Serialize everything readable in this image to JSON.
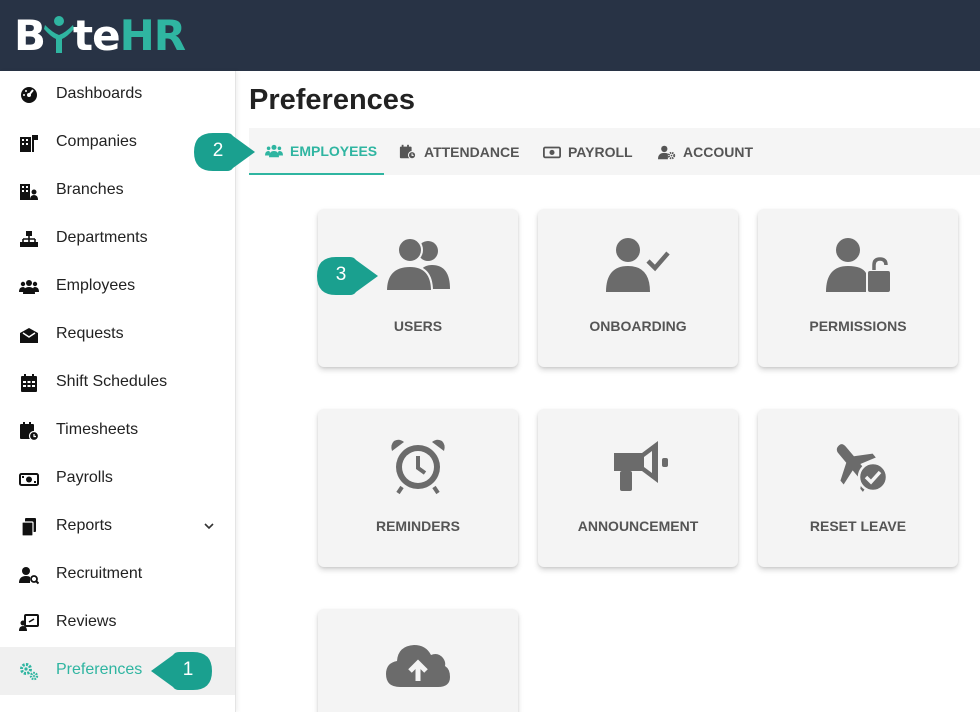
{
  "header": {
    "logo_prefix": "B",
    "logo_mid": "te",
    "logo_suffix": "HR"
  },
  "sidebar": {
    "items": [
      {
        "label": "Dashboards",
        "icon": "dashboard-gauge-icon"
      },
      {
        "label": "Companies",
        "icon": "building-flag-icon"
      },
      {
        "label": "Branches",
        "icon": "building-user-icon"
      },
      {
        "label": "Departments",
        "icon": "sitemap-icon"
      },
      {
        "label": "Employees",
        "icon": "users-icon"
      },
      {
        "label": "Requests",
        "icon": "envelope-open-icon"
      },
      {
        "label": "Shift Schedules",
        "icon": "calendar-icon"
      },
      {
        "label": "Timesheets",
        "icon": "calendar-clock-icon"
      },
      {
        "label": "Payrolls",
        "icon": "money-bill-icon"
      },
      {
        "label": "Reports",
        "icon": "copy-file-icon"
      },
      {
        "label": "Recruitment",
        "icon": "user-search-icon"
      },
      {
        "label": "Reviews",
        "icon": "chalkboard-user-icon"
      },
      {
        "label": "Preferences",
        "icon": "gears-icon"
      }
    ],
    "active": "Preferences"
  },
  "main": {
    "title": "Preferences",
    "tabs": [
      {
        "label": "EMPLOYEES",
        "icon": "users-icon",
        "active": true
      },
      {
        "label": "ATTENDANCE",
        "icon": "calendar-clock-icon",
        "active": false
      },
      {
        "label": "PAYROLL",
        "icon": "money-bill-icon",
        "active": false
      },
      {
        "label": "ACCOUNT",
        "icon": "user-gear-icon",
        "active": false
      }
    ],
    "cards": [
      {
        "label": "USERS",
        "icon": "users-icon"
      },
      {
        "label": "ONBOARDING",
        "icon": "user-check-icon"
      },
      {
        "label": "PERMISSIONS",
        "icon": "user-lock-icon"
      },
      {
        "label": "REMINDERS",
        "icon": "alarm-clock-icon"
      },
      {
        "label": "ANNOUNCEMENT",
        "icon": "bullhorn-icon"
      },
      {
        "label": "RESET LEAVE",
        "icon": "plane-check-icon"
      },
      {
        "label": "",
        "icon": "cloud-upload-icon"
      }
    ]
  },
  "callouts": [
    "1",
    "2",
    "3"
  ],
  "colors": {
    "accent": "#2fb5a1",
    "header": "#283345",
    "icon_gray": "#6b6b6b"
  }
}
